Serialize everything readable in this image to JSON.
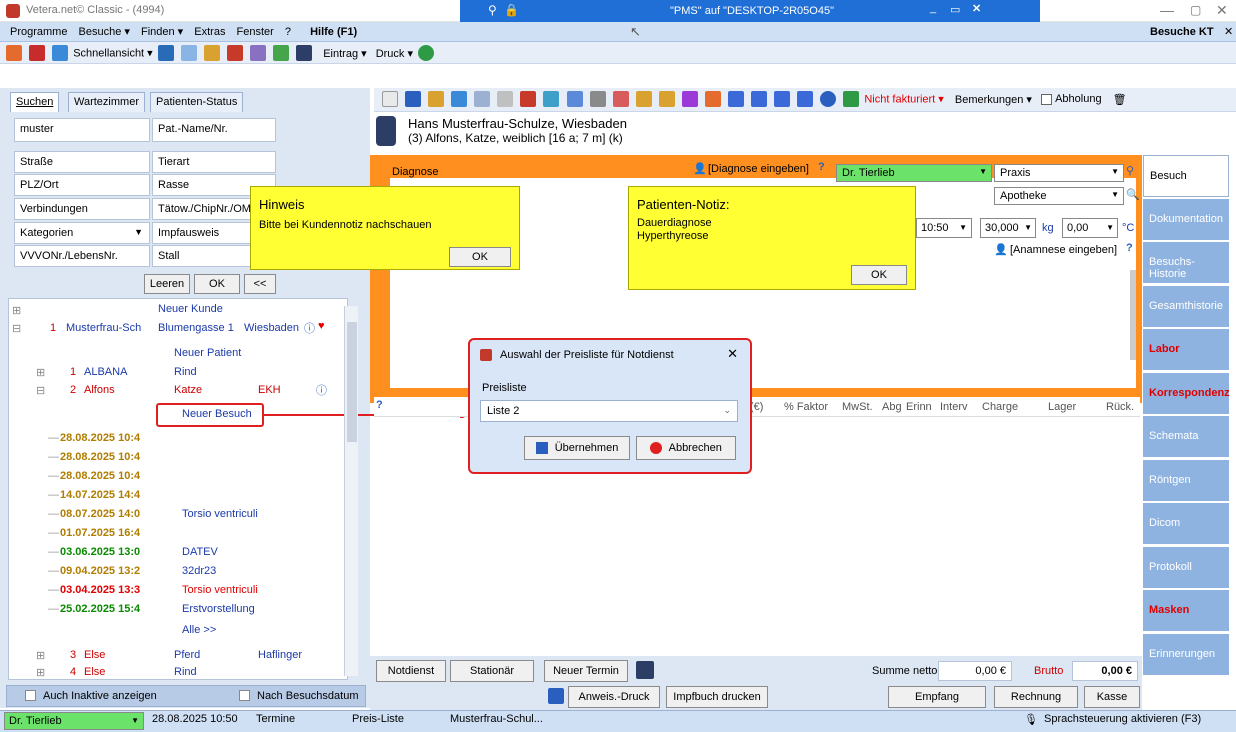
{
  "window": {
    "title": "Vetera.net© Classic - (4994)",
    "remote_title": "\"PMS\" auf \"DESKTOP-2R05O45\""
  },
  "menu": {
    "items": [
      "Programme",
      "Besuche ▾",
      "Finden ▾",
      "Extras",
      "Fenster",
      "?",
      "Hilfe (F1)"
    ],
    "right_label": "Besuche KT"
  },
  "toolbar": {
    "schnellansicht": "Schnellansicht ▾",
    "eintrag": "Eintrag ▾",
    "druck": "Druck ▾",
    "nicht_fakturiert": "Nicht fakturiert ▾",
    "bemerkungen": "Bemerkungen ▾",
    "abholung": "Abholung"
  },
  "left": {
    "tabs": [
      "Suchen",
      "Wartezimmer",
      "Patienten-Status"
    ],
    "search_value": "muster",
    "fields_left": [
      "Straße",
      "PLZ/Ort",
      "Verbindungen",
      "Kategorien",
      "VVVONr./LebensNr."
    ],
    "fields_right": [
      "Pat.-Name/Nr.",
      "Tierart",
      "Rasse",
      "Tätow./ChipNr./OM",
      "Impfausweis",
      "Stall"
    ],
    "buttons": [
      "Leeren",
      "OK",
      "<<"
    ],
    "tree": {
      "neuer_kunde": "Neuer Kunde",
      "customer": {
        "num": "1",
        "name": "Musterfrau-Sch",
        "street": "Blumengasse 1",
        "city": "Wiesbaden"
      },
      "neuer_patient": "Neuer Patient",
      "patients": [
        {
          "num": "1",
          "name": "ALBANA",
          "species": "Rind",
          "breed": ""
        },
        {
          "num": "2",
          "name": "Alfons",
          "species": "Katze",
          "breed": "EKH"
        }
      ],
      "neuer_besuch": "Neuer Besuch",
      "visits": [
        {
          "date": "28.08.2025 10:4",
          "text": "",
          "color": "#b07d00"
        },
        {
          "date": "28.08.2025 10:4",
          "text": "",
          "color": "#b07d00"
        },
        {
          "date": "28.08.2025 10:4",
          "text": "",
          "color": "#b07d00"
        },
        {
          "date": "14.07.2025 14:4",
          "text": "",
          "color": "#b07d00"
        },
        {
          "date": "08.07.2025 14:0",
          "text": "Torsio ventriculi",
          "color": "#b07d00"
        },
        {
          "date": "01.07.2025 16:4",
          "text": "",
          "color": "#b07d00"
        },
        {
          "date": "03.06.2025 13:0",
          "text": "DATEV",
          "color": "#0a8a00"
        },
        {
          "date": "09.04.2025 13:2",
          "text": "32dr23",
          "color": "#b07d00"
        },
        {
          "date": "03.04.2025 13:3",
          "text": "Torsio ventriculi",
          "color": "#e00000"
        },
        {
          "date": "25.02.2025 15:4",
          "text": "Erstvorstellung",
          "color": "#0a8a00"
        }
      ],
      "alle": "Alle >>",
      "more_patients": [
        {
          "num": "3",
          "name": "Else",
          "species": "Pferd",
          "breed": "Haflinger"
        },
        {
          "num": "4",
          "name": "Else",
          "species": "Rind",
          "breed": ""
        }
      ]
    },
    "check_inaktive": "Auch Inaktive anzeigen",
    "check_nach": "Nach Besuchsdatum"
  },
  "header": {
    "owner": "Hans Musterfrau-Schulze, Wiesbaden",
    "patient": "(3) Alfons, Katze, weiblich [16 a; 7 m] (k)"
  },
  "form": {
    "diagnose_label": "Diagnose",
    "diagnose_link": "[Diagnose eingeben]",
    "doctor": "Dr. Tierlieb",
    "praxis": "Praxis",
    "apotheke": "Apotheke",
    "time": "10:50",
    "weight": "30,000",
    "weight_unit": "kg",
    "temp": "0,00",
    "temp_unit": "°C",
    "anamnese_link": "[Anamnese eingeben]"
  },
  "table_headers": [
    "(€)",
    "% Faktor",
    "MwSt.",
    "Abg",
    "Erinn",
    "Interv",
    "Charge",
    "Lager",
    "Rück."
  ],
  "hinweis": {
    "title": "Hinweis",
    "text": "Bitte bei Kundennotiz nachschauen",
    "ok": "OK"
  },
  "notiz": {
    "title": "Patienten-Notiz:",
    "line1": "Dauerdiagnose",
    "line2": "Hyperthyreose",
    "ok": "OK"
  },
  "dialog": {
    "title": "Auswahl der Preisliste für Notdienst",
    "label": "Preisliste",
    "selected": "Liste 2",
    "apply": "Übernehmen",
    "cancel": "Abbrechen"
  },
  "bottom": {
    "buttons": [
      "Notdienst",
      "Stationär",
      "Neuer Termin"
    ],
    "summe_label": "Summe netto",
    "summe_value": "0,00 €",
    "brutto_label": "Brutto",
    "brutto_value": "0,00 €",
    "anweis": "Anweis.-Druck",
    "impfbuch": "Impfbuch drucken",
    "empfang": "Empfang",
    "rechnung": "Rechnung",
    "kasse": "Kasse"
  },
  "nav": [
    {
      "label": "Besuch",
      "color": "#000"
    },
    {
      "label": "Dokumentation",
      "color": "#fff"
    },
    {
      "label": "Besuchs-Historie",
      "color": "#fff"
    },
    {
      "label": "Gesamthistorie",
      "color": "#fff"
    },
    {
      "label": "Labor",
      "color": "#e00000"
    },
    {
      "label": "Korrespondenz",
      "color": "#e00000"
    },
    {
      "label": "Schemata",
      "color": "#fff"
    },
    {
      "label": "Röntgen",
      "color": "#fff"
    },
    {
      "label": "Dicom",
      "color": "#fff"
    },
    {
      "label": "Protokoll",
      "color": "#fff"
    },
    {
      "label": "Masken",
      "color": "#e00000"
    },
    {
      "label": "Erinnerungen",
      "color": "#fff"
    }
  ],
  "status": {
    "doctor": "Dr. Tierlieb",
    "datetime": "28.08.2025 10:50",
    "termine": "Termine",
    "preisliste": "Preis-Liste",
    "customer": "Musterfrau-Schul...",
    "sprach": "Sprachsteuerung aktivieren (F3)"
  },
  "colors": {
    "accent_orange": "#ff8f1f",
    "note_yellow": "#ffff33",
    "nav_blue": "#8fb3e0",
    "alert_red": "#e00000"
  }
}
